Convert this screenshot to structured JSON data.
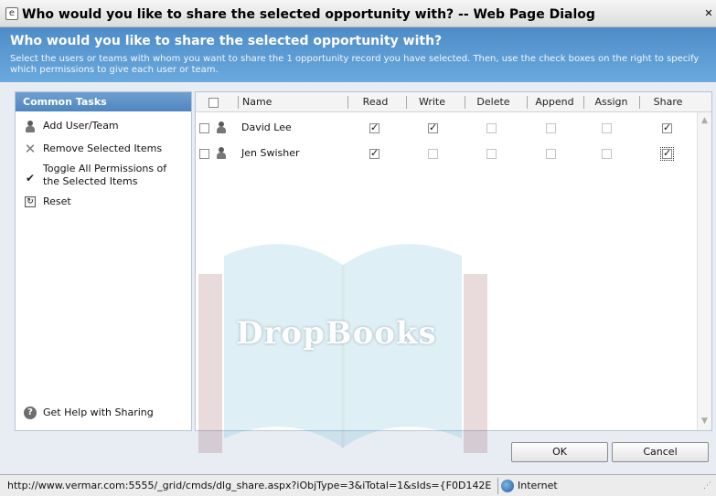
{
  "window": {
    "title": "Who would you like to share the selected opportunity with? -- Web Page Dialog",
    "close_glyph": "✕"
  },
  "header": {
    "title": "Who would you like to share the selected opportunity with?",
    "description": "Select the users or teams with whom you want to share the 1 opportunity record you have selected. Then, use the check boxes on the right to specify which permissions to give each user or team."
  },
  "tasks": {
    "heading": "Common Tasks",
    "items": [
      {
        "label": "Add User/Team",
        "icon": "user-icon"
      },
      {
        "label": "Remove Selected Items",
        "icon": "remove-icon"
      },
      {
        "label": "Toggle All Permissions of the Selected Items",
        "icon": "checkmark-icon"
      },
      {
        "label": "Reset",
        "icon": "reset-icon"
      }
    ],
    "help": "Get Help with Sharing"
  },
  "grid": {
    "columns": [
      "Name",
      "Read",
      "Write",
      "Delete",
      "Append",
      "Assign",
      "Share"
    ],
    "rows": [
      {
        "name": "David Lee",
        "selected": false,
        "read": true,
        "write": true,
        "delete": false,
        "append": false,
        "assign": false,
        "share": true
      },
      {
        "name": "Jen Swisher",
        "selected": false,
        "read": true,
        "write": false,
        "delete": false,
        "append": false,
        "assign": false,
        "share": true
      }
    ]
  },
  "buttons": {
    "ok": "OK",
    "cancel": "Cancel"
  },
  "statusbar": {
    "url": "http://www.vermar.com:5555/_grid/cmds/dlg_share.aspx?iObjType=3&iTotal=1&sIds={F0D142E",
    "zone": "Internet"
  },
  "watermark": {
    "text": "DropBooks"
  }
}
